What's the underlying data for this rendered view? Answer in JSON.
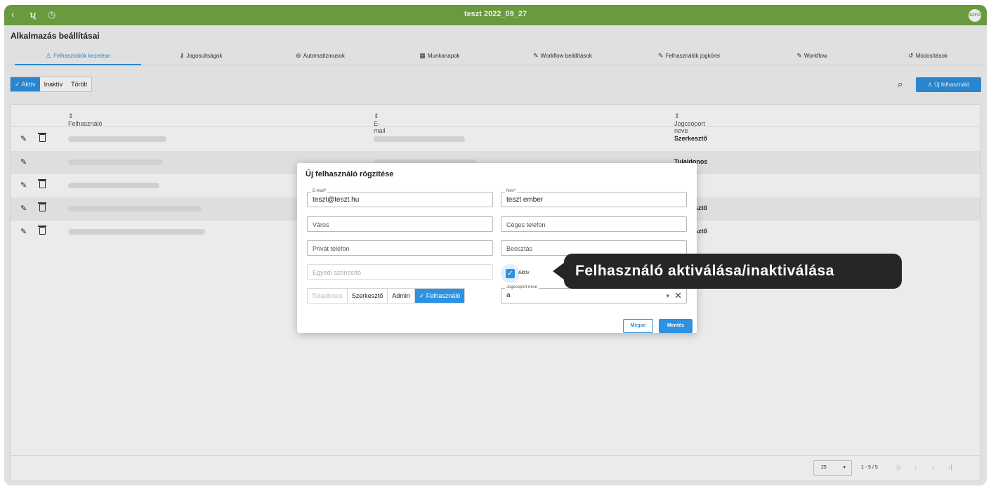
{
  "window": {
    "title": "teszt 2022_09_27",
    "avatar": "SZFG"
  },
  "page": {
    "title": "Alkalmazás beállításai"
  },
  "tabs": [
    {
      "label": "Felhasználók kezelése",
      "icon": "user-icon"
    },
    {
      "label": "Jogosultságok",
      "icon": "key-icon"
    },
    {
      "label": "Automatizmusok",
      "icon": "robot-icon"
    },
    {
      "label": "Munkanapok",
      "icon": "calendar-icon"
    },
    {
      "label": "Workflow beállítások",
      "icon": "pencil-icon"
    },
    {
      "label": "Felhasználók jogkörei",
      "icon": "pencil-icon"
    },
    {
      "label": "Workflow",
      "icon": "pencil-icon"
    },
    {
      "label": "Módosítások",
      "icon": "history-icon"
    }
  ],
  "filters": {
    "active": "Aktív",
    "inactive": "Inaktív",
    "deleted": "Törölt"
  },
  "toolbar": {
    "new_user": "Új felhasználó"
  },
  "table": {
    "columns": {
      "user": "Felhasználó",
      "email": "E-mail",
      "group": "Jogcsoport neve"
    },
    "rows": [
      {
        "group": "Szerkesztő"
      },
      {
        "group": "Tulajdonos"
      },
      {
        "group": ""
      },
      {
        "group": "Szerkesztő"
      },
      {
        "group": "Szerkesztő"
      }
    ],
    "page_size": "25",
    "range": "1 - 5 / 5"
  },
  "modal": {
    "title": "Új felhasználó rögzítése",
    "email_label": "E-mail*",
    "email_value": "teszt@teszt.hu",
    "name_label": "Név*",
    "name_value": "teszt ember",
    "city_placeholder": "Város",
    "company_phone_placeholder": "Céges telefon",
    "private_phone_placeholder": "Privát telefon",
    "position_placeholder": "Beosztás",
    "identifier_placeholder": "Egyedi azonosító",
    "active_label": "Aktív",
    "active_checked": true,
    "roles": [
      "Tulajdonos",
      "Szerkesztő",
      "Admin",
      "Felhasználó"
    ],
    "selected_role": "Felhasználó",
    "group_label": "Jogcsoport neve",
    "group_value": "a",
    "cancel": "Mégse",
    "save": "Mentés"
  },
  "tooltip": {
    "text": "Felhasználó aktiválása/inaktiválása"
  },
  "colors": {
    "topbar": "#74a844",
    "accent": "#2d92e0",
    "tooltip": "#262626"
  }
}
